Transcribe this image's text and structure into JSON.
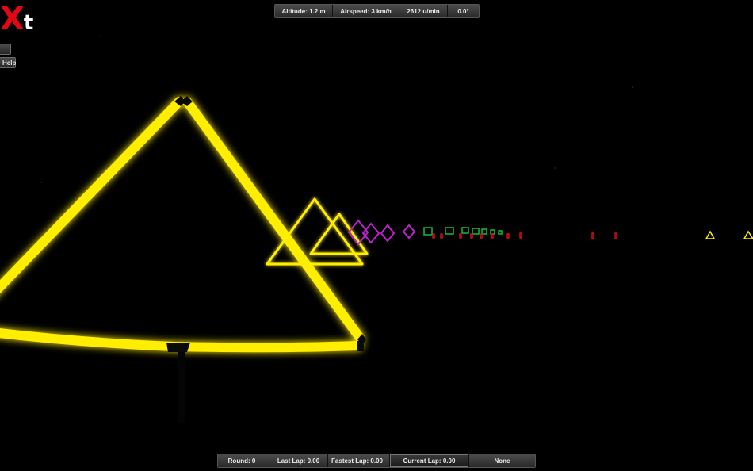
{
  "logo": {
    "letter_x": "X",
    "letter_t": "t"
  },
  "side_buttons": {
    "top_label": "",
    "help_label": "Help"
  },
  "top_hud": {
    "altitude": "Altitude: 1.2 m",
    "airspeed": "Airspeed: 3 km/h",
    "rpm": "2612 u/min",
    "angle": "0.0°"
  },
  "bottom_hud": {
    "round": "Round: 0",
    "last_lap": "Last Lap: 0.00",
    "fastest_lap": "Fastest Lap: 0.00",
    "current_lap": "Current Lap: 0.00",
    "best_pilot": "None"
  },
  "colors": {
    "gate_yellow": "#ffee00",
    "diamond_magenta": "#c020d0",
    "square_green": "#10c030",
    "marker_red": "#e01010",
    "logo_red": "#e30613"
  }
}
